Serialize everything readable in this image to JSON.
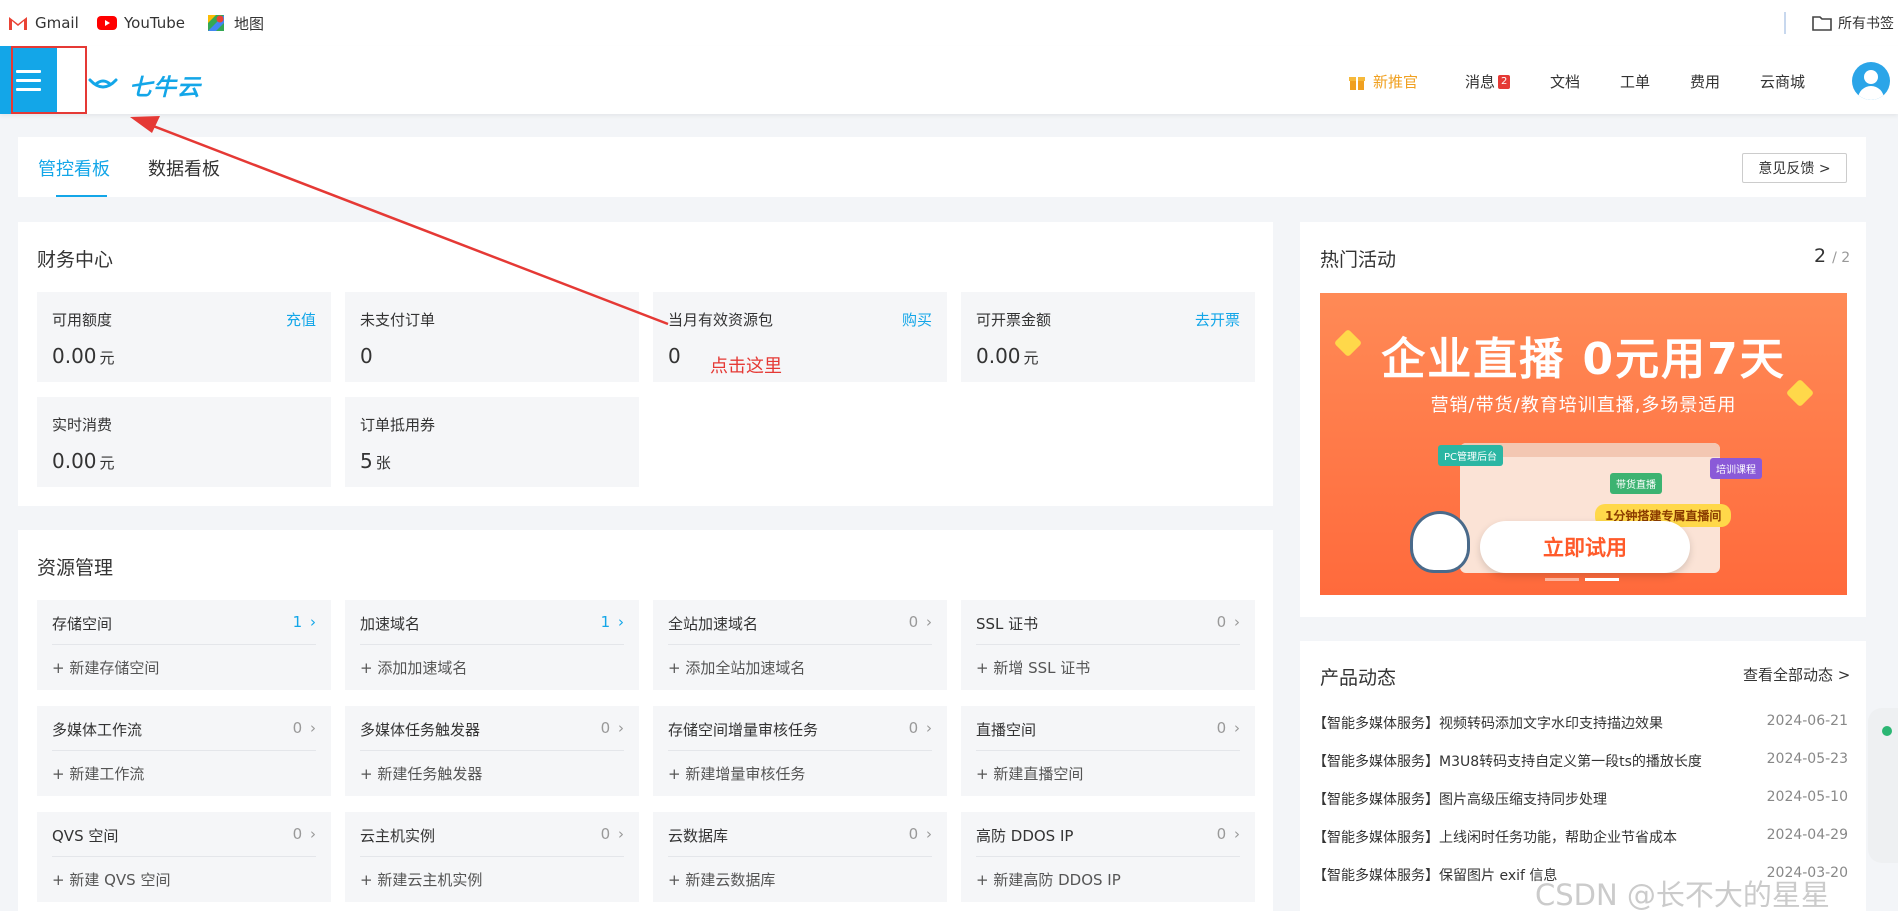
{
  "bookmarks": [
    {
      "label": "Gmail",
      "icon": "gmail-icon"
    },
    {
      "label": "YouTube",
      "icon": "youtube-icon"
    },
    {
      "label": "地图",
      "icon": "maps-icon"
    }
  ],
  "bookmarks_all": "所有书签",
  "logo_text": "七牛云",
  "nav": {
    "new_promo": "新推官",
    "messages": "消息",
    "messages_badge": "2",
    "docs": "文档",
    "tickets": "工单",
    "billing": "费用",
    "cloud_mall": "云商城"
  },
  "tabs": [
    "管控看板",
    "数据看板"
  ],
  "feedback_label": "意见反馈 >",
  "finance": {
    "title": "财务中心",
    "tiles": [
      {
        "label": "可用额度",
        "value": "0.00",
        "unit": "元",
        "link": "充值"
      },
      {
        "label": "未支付订单",
        "value": "0",
        "unit": "",
        "link": ""
      },
      {
        "label": "当月有效资源包",
        "value": "0",
        "unit": "",
        "link": "购买"
      },
      {
        "label": "可开票金额",
        "value": "0.00",
        "unit": "元",
        "link": "去开票"
      },
      {
        "label": "实时消费",
        "value": "0.00",
        "unit": "元",
        "link": ""
      },
      {
        "label": "订单抵用券",
        "value": "5",
        "unit": "张",
        "link": ""
      }
    ]
  },
  "resources": {
    "title": "资源管理",
    "items": [
      {
        "label": "存储空间",
        "count": "1",
        "add": "新建存储空间"
      },
      {
        "label": "加速域名",
        "count": "1",
        "add": "添加加速域名"
      },
      {
        "label": "全站加速域名",
        "count": "0",
        "add": "添加全站加速域名"
      },
      {
        "label": "SSL 证书",
        "count": "0",
        "add": "新增 SSL 证书"
      },
      {
        "label": "多媒体工作流",
        "count": "0",
        "add": "新建工作流"
      },
      {
        "label": "多媒体任务触发器",
        "count": "0",
        "add": "新建任务触发器"
      },
      {
        "label": "存储空间增量审核任务",
        "count": "0",
        "add": "新建增量审核任务"
      },
      {
        "label": "直播空间",
        "count": "0",
        "add": "新建直播空间"
      },
      {
        "label": "QVS 空间",
        "count": "0",
        "add": "新建 QVS 空间"
      },
      {
        "label": "云主机实例",
        "count": "0",
        "add": "新建云主机实例"
      },
      {
        "label": "云数据库",
        "count": "0",
        "add": "新建云数据库"
      },
      {
        "label": "高防 DDOS IP",
        "count": "0",
        "add": "新建高防 DDOS IP"
      }
    ]
  },
  "activities": {
    "title": "热门活动",
    "page": "2",
    "total": "/ 2",
    "banner_title": "企业直播 0元用7天",
    "banner_subtitle": "营销/带货/教育培训直播,多场景适用",
    "banner_chip_pc": "PC管理后台",
    "banner_chip_live": "带货直播",
    "banner_chip_train": "培训课程",
    "banner_tag": "1分钟搭建专属直播间",
    "banner_cta": "立即试用"
  },
  "news": {
    "title": "产品动态",
    "view_all": "查看全部动态 >",
    "items": [
      {
        "text": "【智能多媒体服务】视频转码添加文字水印支持描边效果",
        "date": "2024-06-21"
      },
      {
        "text": "【智能多媒体服务】M3U8转码支持自定义第一段ts的播放长度",
        "date": "2024-05-23"
      },
      {
        "text": "【智能多媒体服务】图片高级压缩支持同步处理",
        "date": "2024-05-10"
      },
      {
        "text": "【智能多媒体服务】上线闲时任务功能，帮助企业节省成本",
        "date": "2024-04-29"
      },
      {
        "text": "【智能多媒体服务】保留图片 exif 信息",
        "date": "2024-03-20"
      }
    ]
  },
  "annotation": "点击这里",
  "watermark": "CSDN @长不大的星星",
  "colors": {
    "accent": "#13a6e8",
    "alert": "#e53935",
    "promo": "#f0a020"
  }
}
